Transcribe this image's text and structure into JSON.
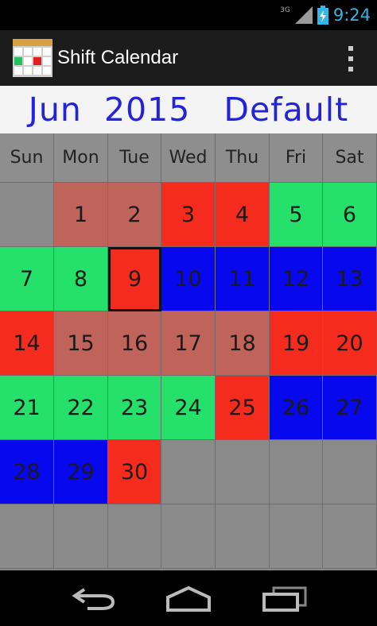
{
  "status_bar": {
    "network": "3G",
    "time": "9:24"
  },
  "app": {
    "title": "Shift Calendar"
  },
  "header": {
    "month": "Jun",
    "year": "2015",
    "profile": "Default"
  },
  "calendar": {
    "weekdays": [
      "Sun",
      "Mon",
      "Tue",
      "Wed",
      "Thu",
      "Fri",
      "Sat"
    ],
    "today": "9",
    "weeks": [
      [
        null,
        "1",
        "2",
        "3",
        "4",
        "5",
        "6"
      ],
      [
        "7",
        "8",
        "9",
        "10",
        "11",
        "12",
        "13"
      ],
      [
        "14",
        "15",
        "16",
        "17",
        "18",
        "19",
        "20"
      ],
      [
        "21",
        "22",
        "23",
        "24",
        "25",
        "26",
        "27"
      ],
      [
        "28",
        "29",
        "30",
        null,
        null,
        null,
        null
      ],
      [
        null,
        null,
        null,
        null,
        null,
        null,
        null
      ]
    ],
    "shift_colors": {
      "empty": "#8a8a8a",
      "rose": "#c0635a",
      "red": "#f52b1e",
      "green": "#25e06a",
      "blue": "#0808ee"
    },
    "shifts": [
      [
        "empty",
        "rose",
        "rose",
        "red",
        "red",
        "green",
        "green"
      ],
      [
        "green",
        "green",
        "red",
        "blue",
        "blue",
        "blue",
        "blue"
      ],
      [
        "red",
        "rose",
        "rose",
        "rose",
        "rose",
        "red",
        "red"
      ],
      [
        "green",
        "green",
        "green",
        "green",
        "red",
        "blue",
        "blue"
      ],
      [
        "blue",
        "blue",
        "red",
        "empty",
        "empty",
        "empty",
        "empty"
      ],
      [
        "empty",
        "empty",
        "empty",
        "empty",
        "empty",
        "empty",
        "empty"
      ]
    ]
  }
}
